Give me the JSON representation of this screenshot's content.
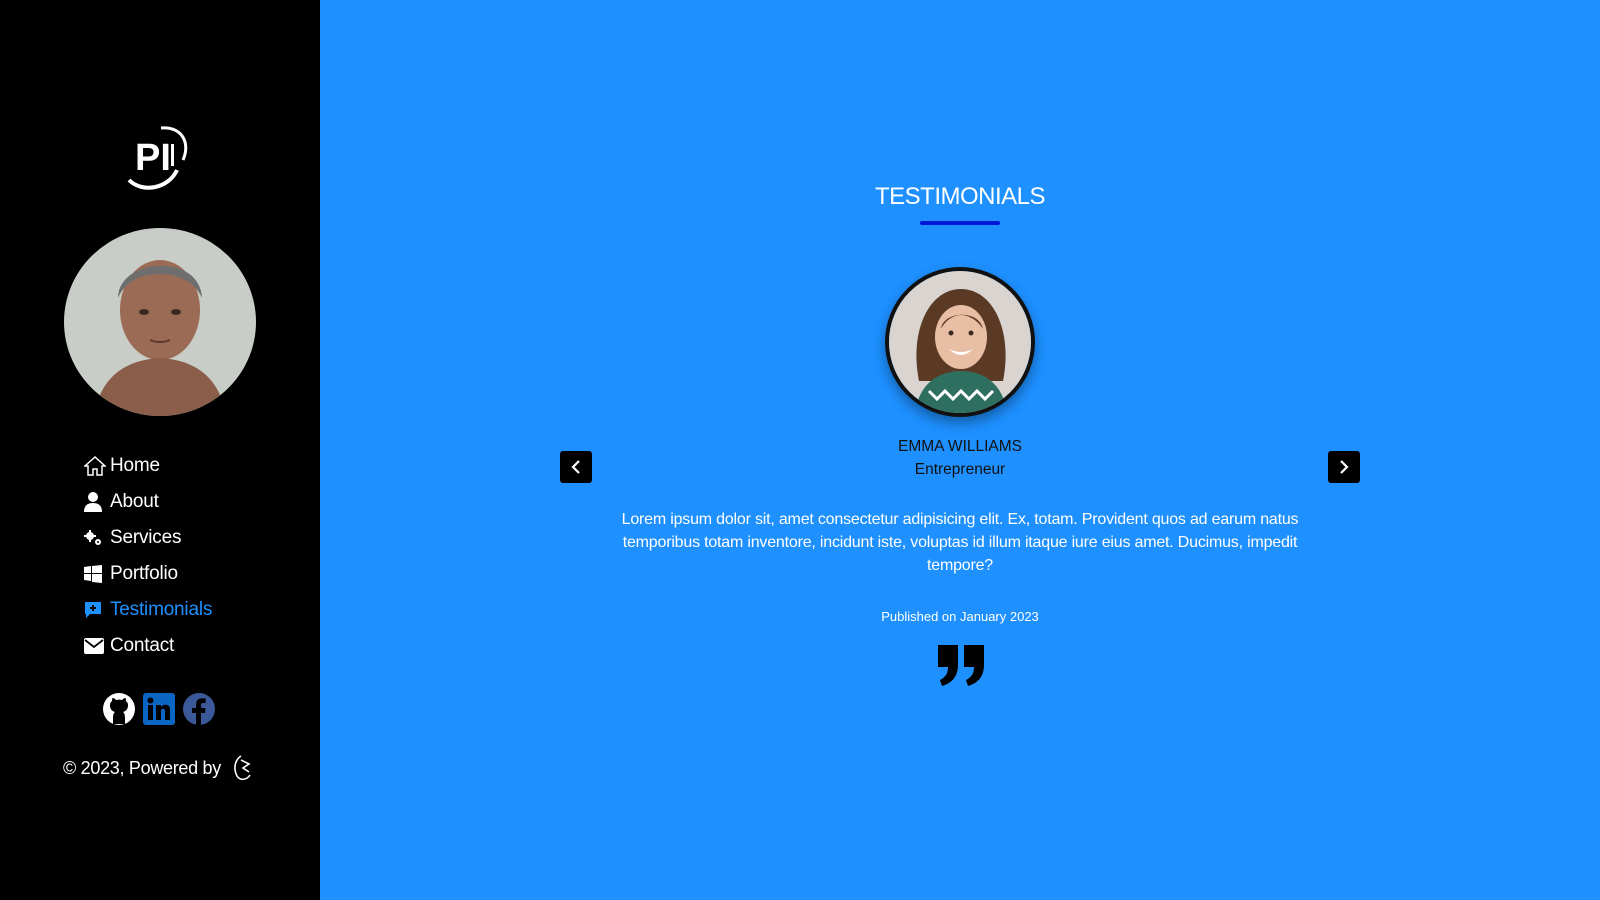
{
  "sidebar": {
    "nav": [
      {
        "label": "Home",
        "icon": "home-icon"
      },
      {
        "label": "About",
        "icon": "user-icon"
      },
      {
        "label": "Services",
        "icon": "gears-icon"
      },
      {
        "label": "Portfolio",
        "icon": "windows-icon"
      },
      {
        "label": "Testimonials",
        "icon": "comment-plus-icon",
        "active": true
      },
      {
        "label": "Contact",
        "icon": "envelope-icon"
      }
    ],
    "social": [
      "github-icon",
      "linkedin-icon",
      "facebook-icon"
    ],
    "footer": "© 2023, Powered by"
  },
  "main": {
    "title": "TESTIMONIALS",
    "testimonial": {
      "name": "EMMA WILLIAMS",
      "role": "Entrepreneur",
      "text": "Lorem ipsum dolor sit, amet consectetur adipisicing elit. Ex, totam. Provident quos ad earum natus temporibus totam inventore, incidunt iste, voluptas id illum itaque iure eius amet. Ducimus, impedit tempore?",
      "published": "Published on January 2023"
    }
  },
  "colors": {
    "accent": "#1e90ff",
    "sidebar_bg": "#000000",
    "underline": "#0016d6",
    "linkedin": "#0a66c2",
    "facebook": "#3b5998"
  }
}
